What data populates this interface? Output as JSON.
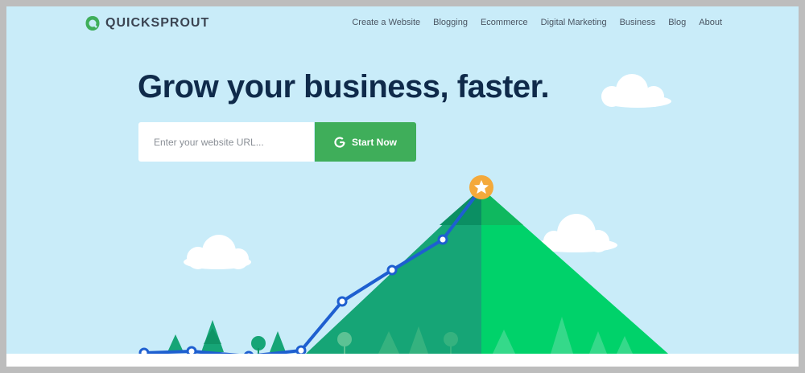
{
  "brand": {
    "name": "QUICKSPROUT",
    "color": "#3fae5a"
  },
  "nav": {
    "items": [
      "Create a Website",
      "Blogging",
      "Ecommerce",
      "Digital Marketing",
      "Business",
      "Blog",
      "About"
    ]
  },
  "hero": {
    "headline": "Grow your business, faster.",
    "input_placeholder": "Enter your website URL...",
    "cta_label": "Start Now",
    "cta_color": "#3fae5a"
  },
  "illustration": {
    "sky_color": "#c9ecf9",
    "mountain_colors": [
      "#16a576",
      "#00d26a"
    ],
    "line_color": "#1e5fd0",
    "peak_icon": "star-icon"
  }
}
